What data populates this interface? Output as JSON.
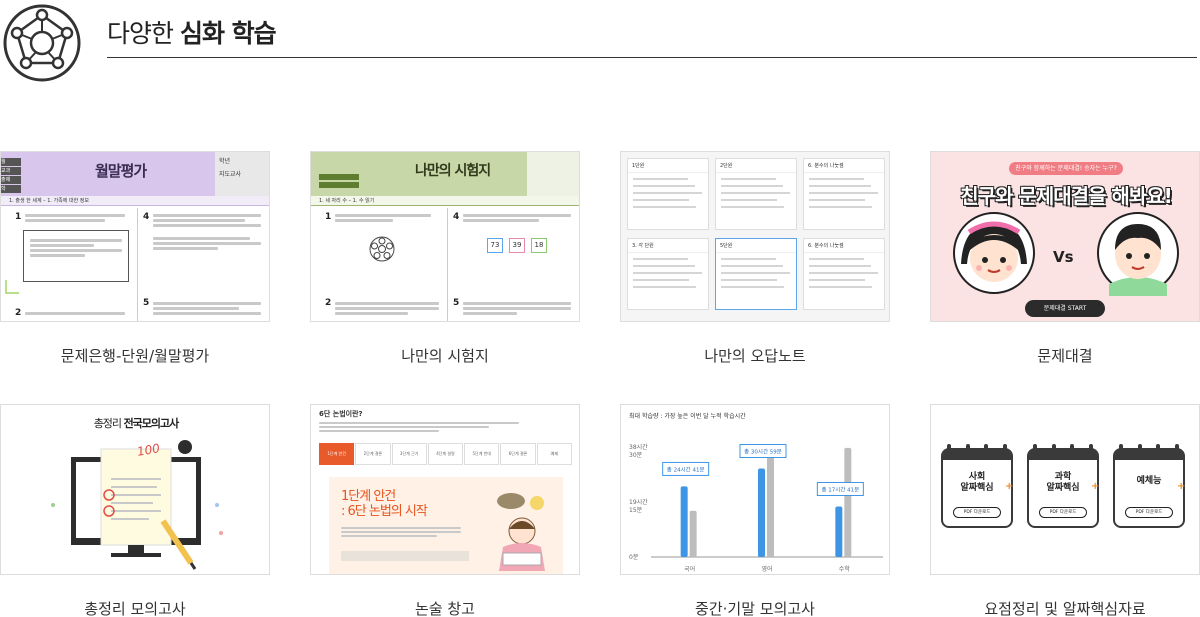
{
  "header": {
    "title_light": "다양한",
    "title_bold": "심화 학습"
  },
  "colors": {
    "accent_orange": "#e8531e",
    "accent_blue": "#4a90e2",
    "battle_pink": "#fbe3e4"
  },
  "cards": [
    {
      "caption": "문제은행-단원/월말평가",
      "thumb": {
        "title": "월말평가",
        "info_rows": [
          "월",
          "교과",
          "출제",
          "학"
        ],
        "right_rows": [
          "학년",
          "지도교사"
        ],
        "subbar": "1. 출생 한 세계 – 1. 가족에 대한 정보",
        "questions": [
          "1",
          "4",
          "2",
          "5"
        ]
      }
    },
    {
      "caption": "나만의 시험지",
      "thumb": {
        "title": "나만의 시험지",
        "subbar": "1. 세 자리 수 – 1. 수 읽기",
        "numbers": [
          "73",
          "39",
          "18"
        ],
        "questions": [
          "1",
          "4",
          "2",
          "5"
        ]
      }
    },
    {
      "caption": "나만의 오답노트",
      "thumb": {
        "panels": [
          "1단원",
          "2단원",
          "6. 분수의 나눗셈",
          "3. 각 단원",
          "5단원",
          "6. 분수의 나눗셈"
        ]
      }
    },
    {
      "caption": "문제대결",
      "thumb": {
        "badge": "친구와 함께하는 문제대결! 승자는 누구?",
        "title": "친구와 문제대결을 해봐요!",
        "vs": "Vs",
        "start": "문제대결 START"
      }
    },
    {
      "caption": "총정리 모의고사",
      "thumb": {
        "title_light": "총정리",
        "title_bold": "전국모의고사",
        "score": "100"
      }
    },
    {
      "caption": "논술 창고",
      "thumb": {
        "subtitle": "6단 논법이란?",
        "steps": [
          "1단계 안건",
          "2단계 결론",
          "3단계 근거",
          "4단계 설명",
          "5단계 반대",
          "6단계 결론",
          "예제"
        ],
        "heading_line1": "1단계 안건",
        "heading_line2": ": 6단 논법의 시작"
      }
    },
    {
      "caption": "중간·기말 모의고사",
      "thumb": {
        "chart_title": "최대 학습량 : 가장 높은 이번 달 누적 학습시간"
      }
    },
    {
      "caption": "요점정리 및 알짜핵심자료",
      "thumb": {
        "booklets": [
          {
            "name": "사회\n알짜핵심",
            "pdf": "PDF 다운로드"
          },
          {
            "name": "과학\n알짜핵심",
            "pdf": "PDF 다운로드"
          },
          {
            "name": "예체능",
            "pdf": "PDF 다운로드"
          }
        ]
      }
    }
  ],
  "chart_data": {
    "type": "bar",
    "title": "최대 학습량 : 가장 높은 이번 달 누적 학습시간",
    "categories": [
      "국어",
      "영어",
      "수학"
    ],
    "yticks": [
      "38시간 30분",
      "19시간 15분",
      "0분"
    ],
    "series": [
      {
        "values": [
          24.7,
          30.98,
          17.68
        ]
      },
      {
        "values": [
          16.2,
          37.5,
          38.2
        ]
      }
    ],
    "annotations": [
      "총 24시간 41분",
      "총 30시간 59분",
      "총 17시간 41분"
    ],
    "ylim": [
      0,
      38.5
    ]
  }
}
